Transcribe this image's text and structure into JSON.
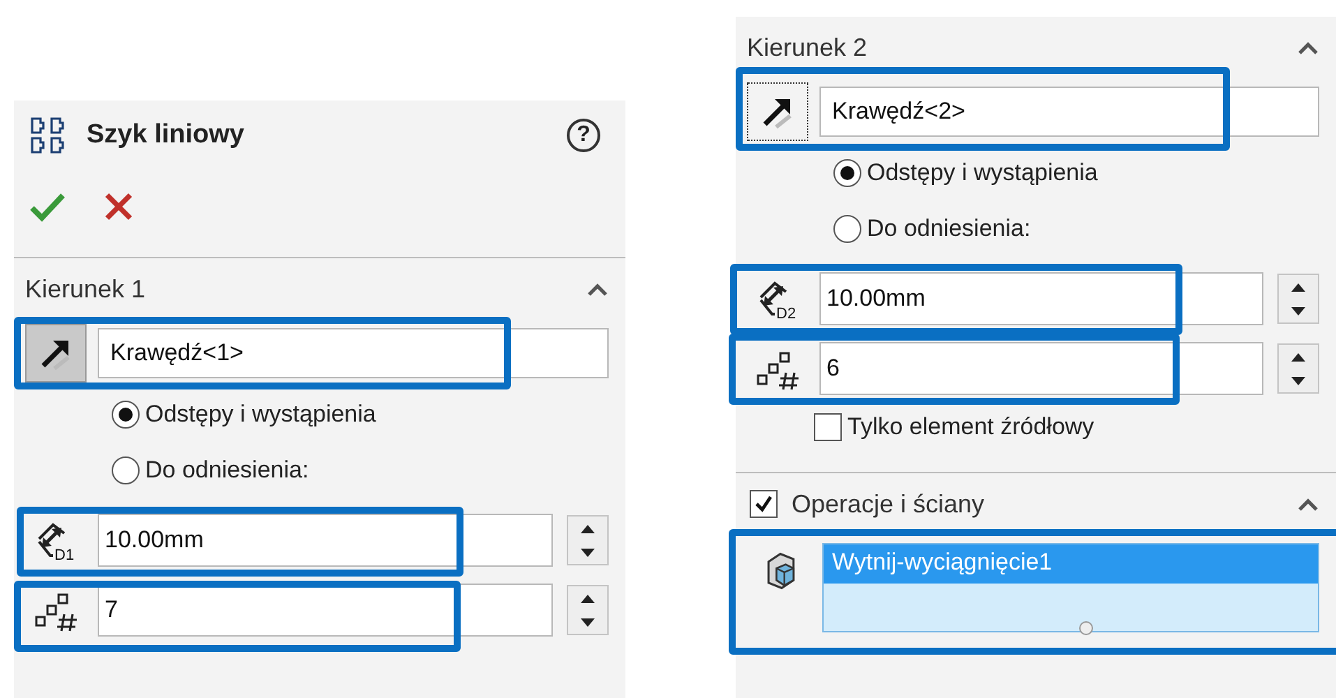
{
  "header": {
    "title": "Szyk liniowy",
    "help": "?"
  },
  "directions": [
    {
      "title": "Kierunek 1",
      "expanded": true,
      "edge": {
        "value": "Krawędź<1>",
        "highlighted": true
      },
      "options": [
        {
          "label": "Odstępy i wystąpienia",
          "selected": true
        },
        {
          "label": "Do odniesienia:",
          "selected": false
        }
      ],
      "spacing": {
        "value": "10.00mm",
        "badge": "D1",
        "highlighted": true
      },
      "instances": {
        "value": "7",
        "highlighted": true
      }
    },
    {
      "title": "Kierunek 2",
      "expanded": true,
      "edge": {
        "value": "Krawędź<2>",
        "highlighted": true
      },
      "options": [
        {
          "label": "Odstępy i wystąpienia",
          "selected": true
        },
        {
          "label": "Do odniesienia:",
          "selected": false
        }
      ],
      "spacing": {
        "value": "10.00mm",
        "badge": "D2",
        "highlighted": true
      },
      "instances": {
        "value": "6",
        "highlighted": true
      }
    }
  ],
  "seed_only": {
    "label": "Tylko element źródłowy",
    "checked": false
  },
  "features_faces": {
    "label": "Operacje i ściany",
    "checked": true,
    "expanded": true,
    "highlighted": true,
    "items": [
      {
        "label": "Wytnij-wyciągnięcie1",
        "selected": true
      }
    ]
  }
}
